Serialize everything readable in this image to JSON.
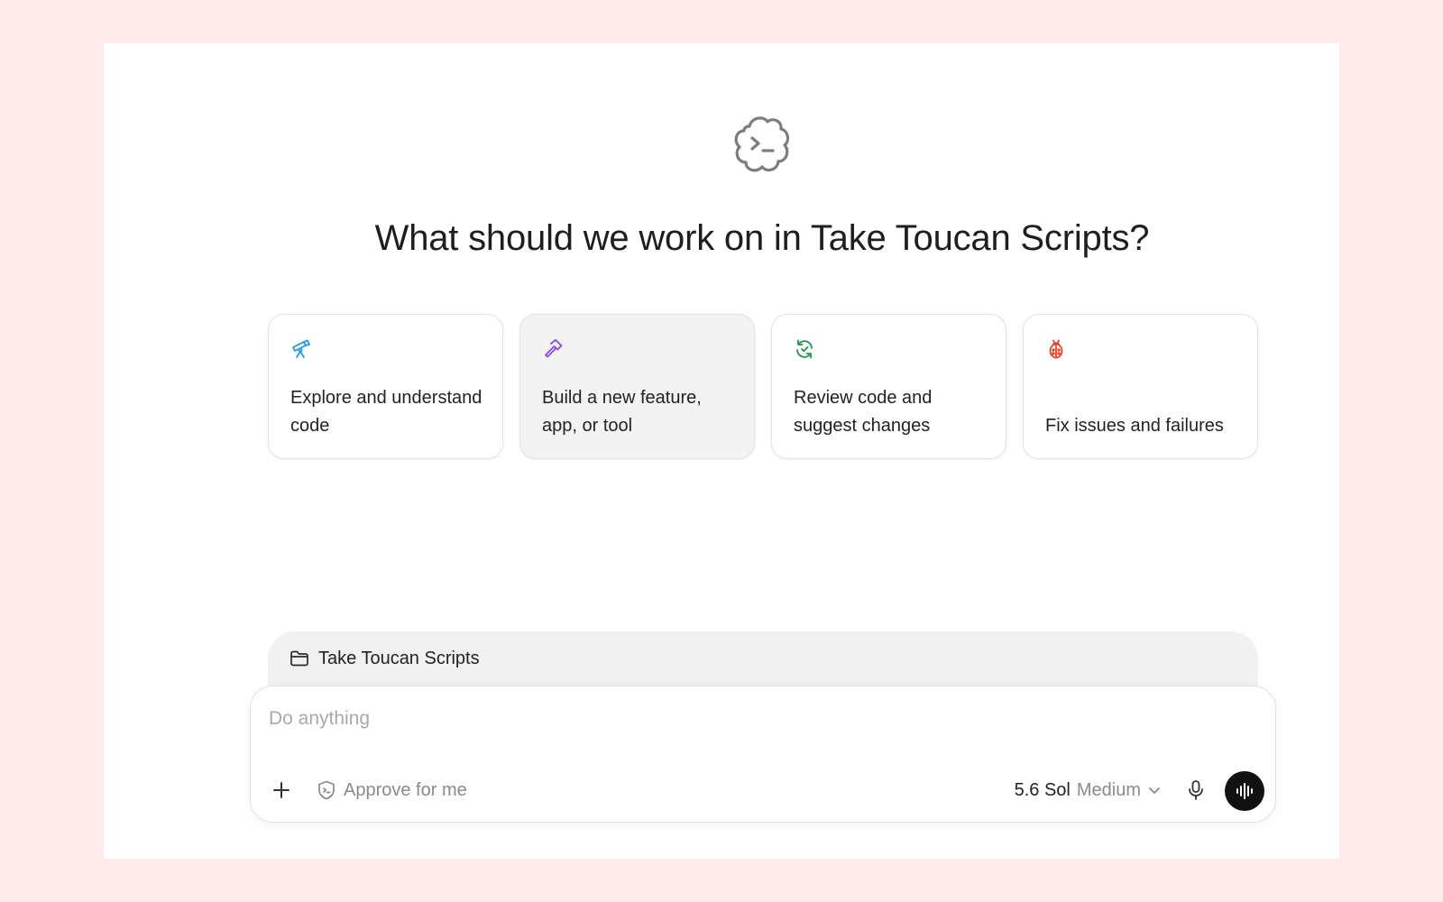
{
  "header": {
    "logo_icon": "codex-cloud-terminal-icon",
    "title": "What should we work on in Take Toucan Scripts?"
  },
  "cards": [
    {
      "label": "Explore and understand code",
      "icon": "telescope-icon",
      "color": "#1e9be8"
    },
    {
      "label": "Build a new feature, app, or tool",
      "icon": "hammer-icon",
      "color": "#8b48e6"
    },
    {
      "label": "Review code and suggest changes",
      "icon": "refresh-check-icon",
      "color": "#1c9a4a"
    },
    {
      "label": "Fix issues and failures",
      "icon": "bug-icon",
      "color": "#e4432d"
    }
  ],
  "project": {
    "icon": "folder-icon",
    "name": "Take Toucan Scripts"
  },
  "composer": {
    "placeholder": "Do anything",
    "value": "",
    "approve_label": "Approve for me",
    "model_name": "5.6 Sol",
    "model_effort": "Medium"
  },
  "colors": {
    "page_background": "#fdecea",
    "window_background": "#ffffff",
    "voice_button": "#111111"
  }
}
